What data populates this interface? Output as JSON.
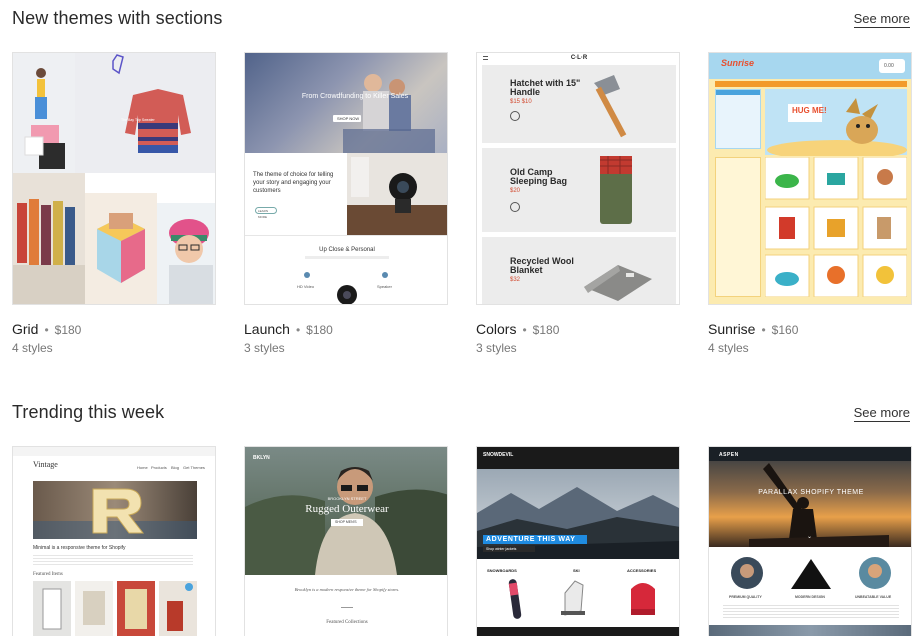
{
  "sections": [
    {
      "title": "New themes with sections",
      "see_more": "See more",
      "cards": [
        {
          "name": "Grid",
          "price": "$180",
          "styles": "4 styles"
        },
        {
          "name": "Launch",
          "price": "$180",
          "styles": "3 styles"
        },
        {
          "name": "Colors",
          "price": "$180",
          "styles": "3 styles"
        },
        {
          "name": "Sunrise",
          "price": "$160",
          "styles": "4 styles"
        }
      ]
    },
    {
      "title": "Trending this week",
      "see_more": "See more",
      "cards": [
        {
          "name": "Vintage"
        },
        {
          "name": "Brooklyn"
        },
        {
          "name": "Snowdevil"
        },
        {
          "name": "Aspen"
        }
      ]
    }
  ],
  "previews": {
    "launch": {
      "hero": "From Crowdfunding to Killer Sales",
      "hero_btn": "SHOP NOW",
      "tagline": "The theme of choice for telling your story and engaging your customers",
      "learn_btn": "LEARN MORE",
      "section": "Up Close & Personal",
      "feat_1": "HD Video",
      "feat_2": "Speaker"
    },
    "colors": {
      "logo": "C·L·R",
      "item_1": "Hatchet with 15\" Handle",
      "price_1": "$15 $10",
      "item_2": "Old Camp Sleeping Bag",
      "price_2": "$20",
      "item_3": "Recycled Wool Blanket",
      "price_3": "$32"
    },
    "sunrise": {
      "logo": "Sunrise",
      "promo": "HUG ME!",
      "currency": "0.00"
    },
    "vintage": {
      "logo": "Vintage",
      "nav": [
        "Home",
        "Products",
        "Blog",
        "Get Themes"
      ],
      "tagline": "Minimal is a responsive theme for Shopify",
      "featured": "Featured Items",
      "letter": "R"
    },
    "brooklyn": {
      "logo": "BKLYN",
      "kicker": "BROOKLYN STREET",
      "hero": "Rugged Outerwear",
      "btn": "SHOP MEN'S",
      "text": "Brooklyn is a modern responsive theme for Shopify stores.",
      "featured": "Featured Collections"
    },
    "snowdevil": {
      "logo": "SNOWDEVIL",
      "hero": "ADVENTURE THIS WAY",
      "btn": "Shop winter jackets",
      "cat_1": "SNOWBOARDS",
      "cat_2": "SKI",
      "cat_3": "ACCESSORIES"
    },
    "aspen": {
      "logo": "ASPEN",
      "hero": "PARALLAX SHOPIFY THEME",
      "feat_1": "PREMIUM QUALITY",
      "feat_2": "MODERN DESIGN",
      "feat_3": "UNBEATABLE VALUE"
    }
  },
  "colors": {
    "accent_red": "#d24a30",
    "snow_blue": "#1f8be0",
    "sunrise_bg": "#fcebb0"
  }
}
